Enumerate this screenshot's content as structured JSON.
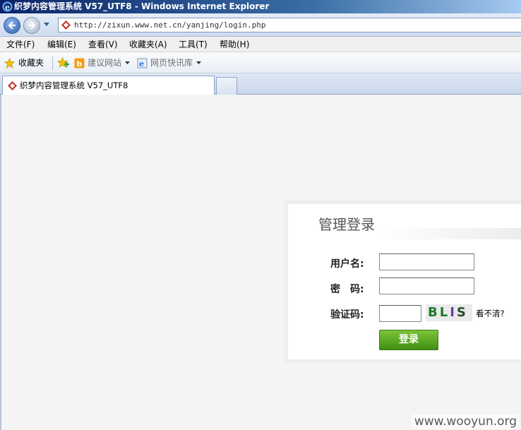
{
  "window": {
    "title": "织梦内容管理系统 V57_UTF8 - Windows Internet Explorer"
  },
  "address_bar": {
    "url": "http://zixun.www.net.cn/yanjing/login.php"
  },
  "menu": {
    "items": [
      "文件(F)",
      "编辑(E)",
      "查看(V)",
      "收藏夹(A)",
      "工具(T)",
      "帮助(H)"
    ]
  },
  "favorites_bar": {
    "favorites_label": "收藏夹",
    "suggested_sites": "建议网站",
    "web_slice_gallery": "网页快讯库"
  },
  "tabs": {
    "active_label": "织梦内容管理系统 V57_UTF8"
  },
  "login": {
    "title": "管理登录",
    "username_label": "用户名:",
    "password_label": "密　码:",
    "captcha_label": "验证码:",
    "captcha_text": [
      "BL",
      "I",
      "S"
    ],
    "refresh_link": "看不清?",
    "submit_label": "登录"
  },
  "watermark": "www.wooyun.org",
  "colors": {
    "login_button": "#5aa823",
    "title_bar": "#0a246a"
  }
}
